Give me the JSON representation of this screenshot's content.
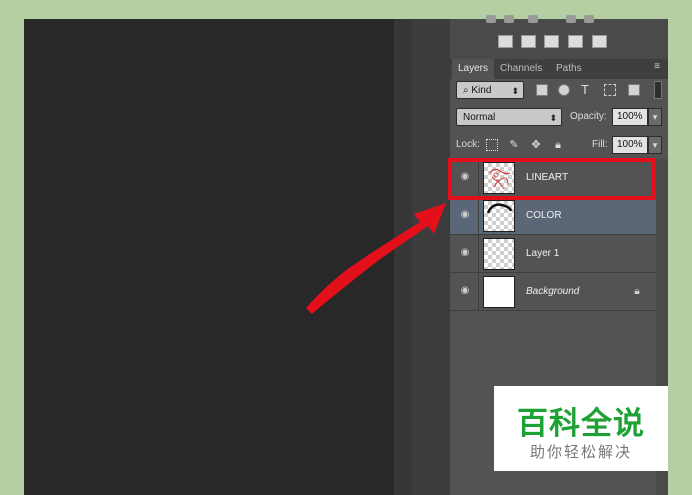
{
  "panel": {
    "tabs": [
      {
        "label": "Layers",
        "active": true
      },
      {
        "label": "Channels",
        "active": false
      },
      {
        "label": "Paths",
        "active": false
      }
    ],
    "menu_icon": "≡",
    "filter": {
      "label": "Kind",
      "prefix_icon": "search-icon"
    },
    "blend_mode": "Normal",
    "opacity": {
      "label": "Opacity:",
      "value": "100%"
    },
    "lock": {
      "label": "Lock:"
    },
    "fill": {
      "label": "Fill:",
      "value": "100%"
    }
  },
  "layers": [
    {
      "name": "LINEART",
      "selected": false,
      "italic": false,
      "locked": false,
      "thumb": "lineart"
    },
    {
      "name": "COLOR",
      "selected": true,
      "italic": false,
      "locked": false,
      "thumb": "color"
    },
    {
      "name": "Layer 1",
      "selected": false,
      "italic": false,
      "locked": false,
      "thumb": "transparent"
    },
    {
      "name": "Background",
      "selected": false,
      "italic": true,
      "locked": true,
      "thumb": "white"
    }
  ],
  "annotation": {
    "color": "#e3101b",
    "highlighted_layer": "LINEART"
  },
  "watermark": {
    "title": "百科全说",
    "subtitle": "助你轻松解决",
    "title_color": "#1fa235"
  }
}
